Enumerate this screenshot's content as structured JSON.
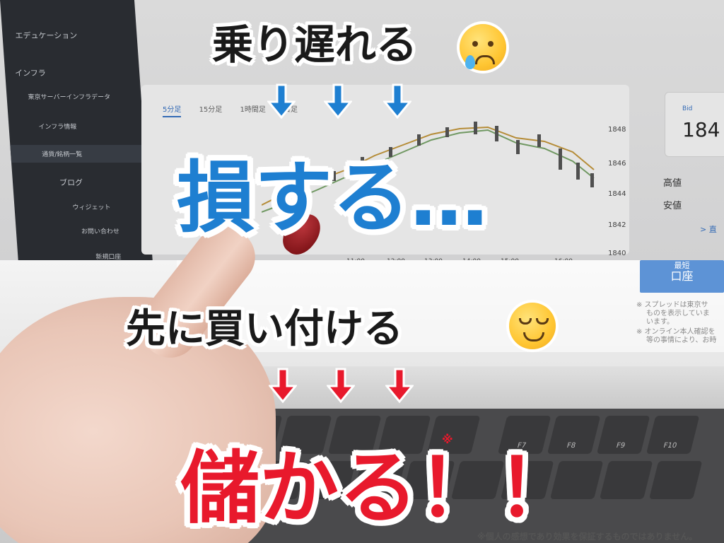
{
  "sidebar": {
    "items": [
      {
        "label": "エデュケーション"
      },
      {
        "label": "インフラ"
      },
      {
        "label": "東京サーバーインフラデータ"
      },
      {
        "label": "インフラ情報"
      },
      {
        "label": "通貨/銘柄一覧"
      },
      {
        "label": "ブログ"
      },
      {
        "label": "ウィジェット"
      },
      {
        "label": "お問い合わせ"
      },
      {
        "label": "新規口座"
      }
    ]
  },
  "chart": {
    "tabs": [
      "5分足",
      "15分足",
      "1時間足",
      "日足"
    ],
    "y_ticks": [
      "1848",
      "1846",
      "1844",
      "1842",
      "1840"
    ],
    "x_ticks": [
      "11:00",
      "12:00",
      "13:00",
      "14:00",
      "15:00",
      "16:00"
    ]
  },
  "quote": {
    "bid_label": "Bid",
    "bid_value": "184",
    "high_label": "高値",
    "low_label": "安値",
    "detail_link": "> 直"
  },
  "cta": {
    "line1": "最短",
    "line2": "口座"
  },
  "notes": [
    "※ スプレッドは東京サ",
    "ものを表示していま",
    "います。",
    "※ オンライン本人確認を",
    "等の事情により、お時"
  ],
  "overlay": {
    "line1": "乗り遅れる",
    "line2": "損する…",
    "line3": "先に買い付ける",
    "line4": "儲かる！！",
    "asterisk": "※",
    "disclaimer": "※個人の感想であり効果を保証するものではありません。",
    "arrow_blue": "#1e7fd1",
    "arrow_red": "#e8192c"
  },
  "keyboard": {
    "keys": [
      "F7",
      "F8",
      "F9",
      "F10"
    ]
  }
}
